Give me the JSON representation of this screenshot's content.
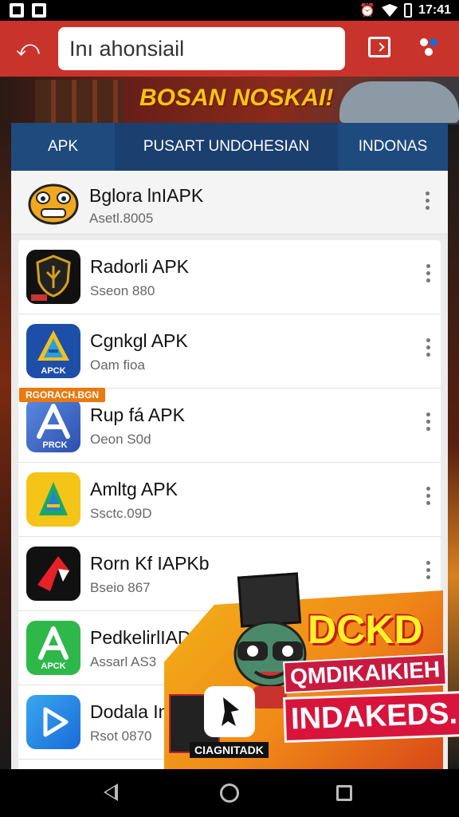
{
  "status_bar": {
    "time": "17:41"
  },
  "app_bar": {
    "search_value": "Inı ahonsiail"
  },
  "banner": {
    "title": "BOSAN NOSKAI!"
  },
  "tabs": [
    {
      "label": "APK"
    },
    {
      "label": "PUSART UNDOHESIAN"
    },
    {
      "label": "INDONAS"
    }
  ],
  "featured": {
    "title": "Bglora lnIAPK",
    "subtitle": "Asetl.8005"
  },
  "apps": [
    {
      "title": "Radorli APK",
      "subtitle": "Sseon 880",
      "icon": "shield-icon",
      "icon_label": ""
    },
    {
      "title": "Cgnkgl APK",
      "subtitle": "Oam fioa",
      "icon": "a-triangle-icon",
      "icon_label": "APCK"
    },
    {
      "title": "Rup fá APK",
      "subtitle": "Oeon S0d",
      "icon": "a-blue-icon",
      "icon_label": "PRCK"
    },
    {
      "title": "Amltg APK",
      "subtitle": "Ssctc.09D",
      "icon": "a-yellow-icon",
      "icon_label": ""
    },
    {
      "title": "Rorn Kf IAPKb",
      "subtitle": "Bseio 867",
      "icon": "red-arrow-icon",
      "icon_label": ""
    },
    {
      "title": "PedkelirlIADK",
      "subtitle": "Assarl AS3",
      "icon": "a-green-icon",
      "icon_label": "APCK"
    },
    {
      "title": "Dodala Im",
      "subtitle": "Rsot 0870",
      "icon": "play-icon",
      "icon_label": ""
    }
  ],
  "promo_tag": "RGORACH.BGN",
  "ad": {
    "headline": "DCKD",
    "line1": "QMDIKAIKIEH",
    "line2": "INDAKEDS.",
    "logo_label": "CIAGNITADK"
  }
}
